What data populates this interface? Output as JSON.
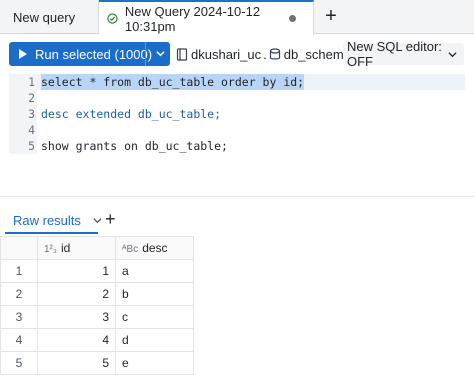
{
  "tabs": [
    {
      "label": "New query",
      "active": false
    },
    {
      "label": "New Query 2024-10-12 10:31pm",
      "active": true,
      "unsaved": true
    }
  ],
  "toolbar": {
    "run_label": "Run selected (1000)",
    "catalog": "dkushari_uc",
    "schema": "db_schema",
    "editor_toggle": "New SQL editor: OFF"
  },
  "editor": {
    "lines": [
      {
        "number": "1",
        "text": "select * from db_uc_table order by id;"
      },
      {
        "number": "2",
        "text": ""
      },
      {
        "number": "3",
        "text": "desc extended db_uc_table;"
      },
      {
        "number": "4",
        "text": ""
      },
      {
        "number": "5",
        "text": "show grants on db_uc_table;"
      }
    ]
  },
  "results": {
    "tab_label": "Raw results",
    "columns": [
      {
        "label": "id",
        "type_icon": "1²₃"
      },
      {
        "label": "desc",
        "type_icon": "ᴬBc"
      }
    ],
    "rows": [
      {
        "index": "1",
        "id": "1",
        "desc": "a"
      },
      {
        "index": "2",
        "id": "2",
        "desc": "b"
      },
      {
        "index": "3",
        "id": "3",
        "desc": "c"
      },
      {
        "index": "4",
        "id": "4",
        "desc": "d"
      },
      {
        "index": "5",
        "id": "5",
        "desc": "e"
      }
    ]
  },
  "colors": {
    "accent": "#1a6ec9",
    "selection": "#b9d5f5"
  }
}
